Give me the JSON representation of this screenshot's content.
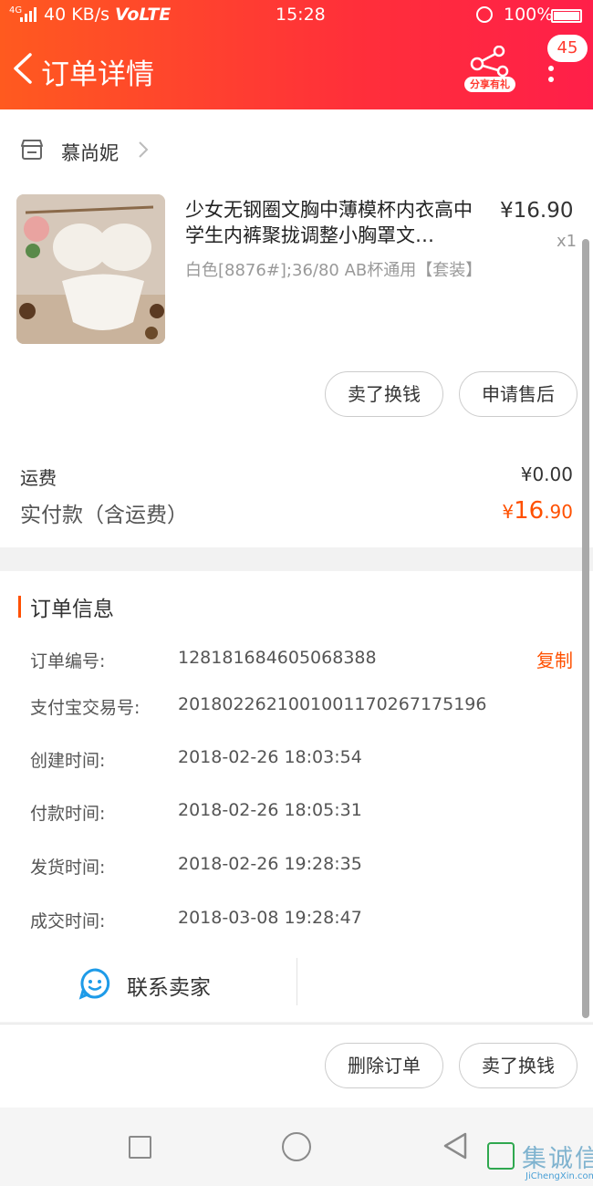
{
  "status_bar": {
    "signal_label": "4G",
    "speed": "40 KB/s",
    "volte": "VoLTE",
    "time": "15:28",
    "battery": "100%"
  },
  "header": {
    "title": "订单详情",
    "share_label": "分享有礼",
    "message_badge": "45"
  },
  "shop": {
    "name": "慕尚妮"
  },
  "product": {
    "title": "少女无钢圈文胸中薄模杯内衣高中学生内裤聚拢调整小胸罩文…",
    "price": "¥16.90",
    "quantity": "x1",
    "sku": "白色[8876#];36/80 AB杯通用【套装】",
    "buttons": [
      "卖了换钱",
      "申请售后"
    ]
  },
  "summary": {
    "shipping_label": "运费",
    "shipping_value": "¥0.00",
    "paid_label": "实付款（含运费）",
    "paid_currency": "¥",
    "paid_integer": "16",
    "paid_decimal": ".90"
  },
  "order_info": {
    "title": "订单信息",
    "copy_label": "复制",
    "rows": [
      {
        "label": "订单编号:",
        "value": "128181684605068388"
      },
      {
        "label": "支付宝交易号:",
        "value": "2018022621001001170267175196"
      },
      {
        "label": "创建时间:",
        "value": "2018-02-26 18:03:54"
      },
      {
        "label": "付款时间:",
        "value": "2018-02-26 18:05:31"
      },
      {
        "label": "发货时间:",
        "value": "2018-02-26 19:28:35"
      },
      {
        "label": "成交时间:",
        "value": "2018-03-08 19:28:47"
      }
    ],
    "contact_label": "联系卖家"
  },
  "footer": {
    "buttons": [
      "删除订单",
      "卖了换钱"
    ]
  },
  "watermark": {
    "cn": "集诚信",
    "en": "JiChengXin.com"
  },
  "colors": {
    "header_start": "#ff5a1f",
    "header_end": "#ff1f49",
    "accent": "#ff5000"
  }
}
